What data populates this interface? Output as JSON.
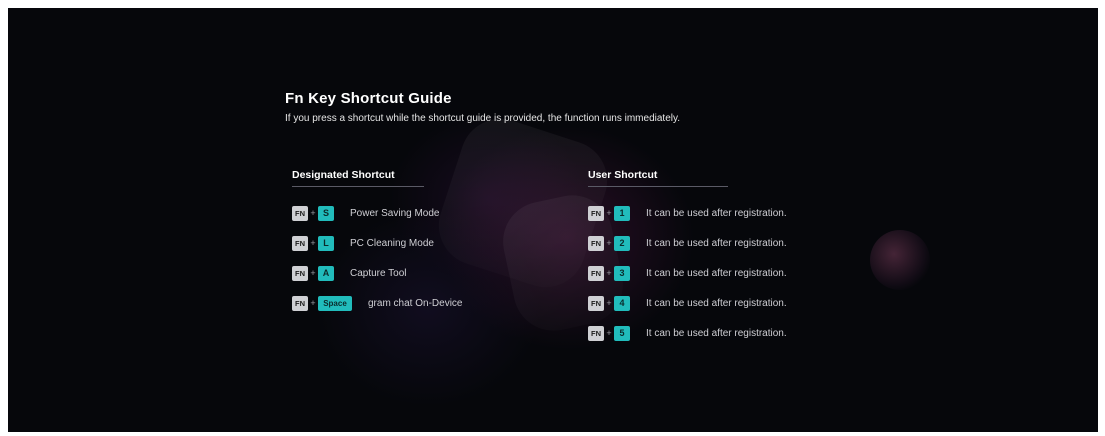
{
  "guide": {
    "title": "Fn Key Shortcut Guide",
    "subtitle": "If you press a shortcut while the shortcut guide is provided, the function runs immediately."
  },
  "designated": {
    "heading": "Designated Shortcut",
    "items": [
      {
        "fn": "FN",
        "plus": "+",
        "key": "S",
        "label": "Power Saving Mode"
      },
      {
        "fn": "FN",
        "plus": "+",
        "key": "L",
        "label": "PC Cleaning Mode"
      },
      {
        "fn": "FN",
        "plus": "+",
        "key": "A",
        "label": "Capture Tool"
      },
      {
        "fn": "FN",
        "plus": "+",
        "key": "Space",
        "label": "gram chat On-Device"
      }
    ]
  },
  "user": {
    "heading": "User Shortcut",
    "items": [
      {
        "fn": "FN",
        "plus": "+",
        "key": "1",
        "label": "It can be used after registration."
      },
      {
        "fn": "FN",
        "plus": "+",
        "key": "2",
        "label": "It can be used after registration."
      },
      {
        "fn": "FN",
        "plus": "+",
        "key": "3",
        "label": "It can be used after registration."
      },
      {
        "fn": "FN",
        "plus": "+",
        "key": "4",
        "label": "It can be used after registration."
      },
      {
        "fn": "FN",
        "plus": "+",
        "key": "5",
        "label": "It can be used after registration."
      }
    ]
  },
  "colors": {
    "background": "#06070b",
    "accent_key": "#21bcbc",
    "fn_key": "#cfd0d4"
  }
}
